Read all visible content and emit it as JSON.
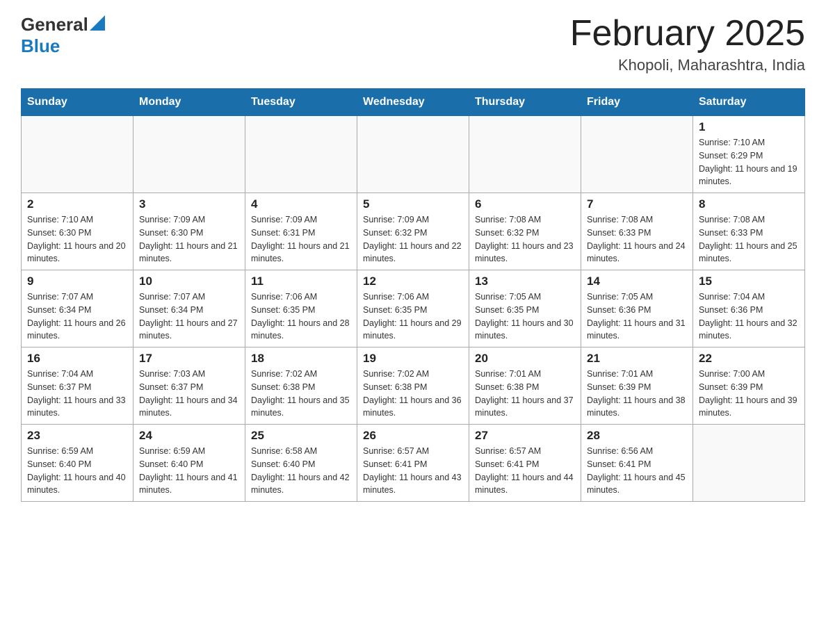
{
  "header": {
    "logo_general": "General",
    "logo_blue": "Blue",
    "title": "February 2025",
    "subtitle": "Khopoli, Maharashtra, India"
  },
  "days_of_week": [
    "Sunday",
    "Monday",
    "Tuesday",
    "Wednesday",
    "Thursday",
    "Friday",
    "Saturday"
  ],
  "weeks": [
    [
      {
        "day": "",
        "info": ""
      },
      {
        "day": "",
        "info": ""
      },
      {
        "day": "",
        "info": ""
      },
      {
        "day": "",
        "info": ""
      },
      {
        "day": "",
        "info": ""
      },
      {
        "day": "",
        "info": ""
      },
      {
        "day": "1",
        "info": "Sunrise: 7:10 AM\nSunset: 6:29 PM\nDaylight: 11 hours and 19 minutes."
      }
    ],
    [
      {
        "day": "2",
        "info": "Sunrise: 7:10 AM\nSunset: 6:30 PM\nDaylight: 11 hours and 20 minutes."
      },
      {
        "day": "3",
        "info": "Sunrise: 7:09 AM\nSunset: 6:30 PM\nDaylight: 11 hours and 21 minutes."
      },
      {
        "day": "4",
        "info": "Sunrise: 7:09 AM\nSunset: 6:31 PM\nDaylight: 11 hours and 21 minutes."
      },
      {
        "day": "5",
        "info": "Sunrise: 7:09 AM\nSunset: 6:32 PM\nDaylight: 11 hours and 22 minutes."
      },
      {
        "day": "6",
        "info": "Sunrise: 7:08 AM\nSunset: 6:32 PM\nDaylight: 11 hours and 23 minutes."
      },
      {
        "day": "7",
        "info": "Sunrise: 7:08 AM\nSunset: 6:33 PM\nDaylight: 11 hours and 24 minutes."
      },
      {
        "day": "8",
        "info": "Sunrise: 7:08 AM\nSunset: 6:33 PM\nDaylight: 11 hours and 25 minutes."
      }
    ],
    [
      {
        "day": "9",
        "info": "Sunrise: 7:07 AM\nSunset: 6:34 PM\nDaylight: 11 hours and 26 minutes."
      },
      {
        "day": "10",
        "info": "Sunrise: 7:07 AM\nSunset: 6:34 PM\nDaylight: 11 hours and 27 minutes."
      },
      {
        "day": "11",
        "info": "Sunrise: 7:06 AM\nSunset: 6:35 PM\nDaylight: 11 hours and 28 minutes."
      },
      {
        "day": "12",
        "info": "Sunrise: 7:06 AM\nSunset: 6:35 PM\nDaylight: 11 hours and 29 minutes."
      },
      {
        "day": "13",
        "info": "Sunrise: 7:05 AM\nSunset: 6:35 PM\nDaylight: 11 hours and 30 minutes."
      },
      {
        "day": "14",
        "info": "Sunrise: 7:05 AM\nSunset: 6:36 PM\nDaylight: 11 hours and 31 minutes."
      },
      {
        "day": "15",
        "info": "Sunrise: 7:04 AM\nSunset: 6:36 PM\nDaylight: 11 hours and 32 minutes."
      }
    ],
    [
      {
        "day": "16",
        "info": "Sunrise: 7:04 AM\nSunset: 6:37 PM\nDaylight: 11 hours and 33 minutes."
      },
      {
        "day": "17",
        "info": "Sunrise: 7:03 AM\nSunset: 6:37 PM\nDaylight: 11 hours and 34 minutes."
      },
      {
        "day": "18",
        "info": "Sunrise: 7:02 AM\nSunset: 6:38 PM\nDaylight: 11 hours and 35 minutes."
      },
      {
        "day": "19",
        "info": "Sunrise: 7:02 AM\nSunset: 6:38 PM\nDaylight: 11 hours and 36 minutes."
      },
      {
        "day": "20",
        "info": "Sunrise: 7:01 AM\nSunset: 6:38 PM\nDaylight: 11 hours and 37 minutes."
      },
      {
        "day": "21",
        "info": "Sunrise: 7:01 AM\nSunset: 6:39 PM\nDaylight: 11 hours and 38 minutes."
      },
      {
        "day": "22",
        "info": "Sunrise: 7:00 AM\nSunset: 6:39 PM\nDaylight: 11 hours and 39 minutes."
      }
    ],
    [
      {
        "day": "23",
        "info": "Sunrise: 6:59 AM\nSunset: 6:40 PM\nDaylight: 11 hours and 40 minutes."
      },
      {
        "day": "24",
        "info": "Sunrise: 6:59 AM\nSunset: 6:40 PM\nDaylight: 11 hours and 41 minutes."
      },
      {
        "day": "25",
        "info": "Sunrise: 6:58 AM\nSunset: 6:40 PM\nDaylight: 11 hours and 42 minutes."
      },
      {
        "day": "26",
        "info": "Sunrise: 6:57 AM\nSunset: 6:41 PM\nDaylight: 11 hours and 43 minutes."
      },
      {
        "day": "27",
        "info": "Sunrise: 6:57 AM\nSunset: 6:41 PM\nDaylight: 11 hours and 44 minutes."
      },
      {
        "day": "28",
        "info": "Sunrise: 6:56 AM\nSunset: 6:41 PM\nDaylight: 11 hours and 45 minutes."
      },
      {
        "day": "",
        "info": ""
      }
    ]
  ]
}
